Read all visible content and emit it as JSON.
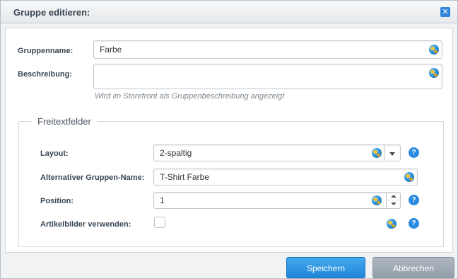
{
  "window": {
    "title": "Gruppe editieren:",
    "close_symbol": "✕"
  },
  "form": {
    "name_label": "Gruppenname:",
    "name_value": "Farbe",
    "description_label": "Beschreibung:",
    "description_value": "",
    "description_hint": "Wird im Storefront als Gruppenbeschreibung angezeigt"
  },
  "freetext": {
    "legend": "Freitextfelder",
    "layout_label": "Layout:",
    "layout_value": "2-spaltig",
    "alt_name_label": "Alternativer Gruppen-Name:",
    "alt_name_value": "T-Shirt Farbe",
    "position_label": "Position:",
    "position_value": "1",
    "images_label": "Artikelbilder verwenden:",
    "images_checked": false,
    "help_symbol": "?"
  },
  "footer": {
    "save_label": "Speichern",
    "cancel_label": "Abbrechen"
  },
  "colors": {
    "primary": "#1f86d8",
    "secondary": "#939ea9",
    "help": "#2a8ae0"
  },
  "icons": [
    "close-icon",
    "globe-icon",
    "help-icon",
    "chevron-down-icon",
    "spin-up-icon",
    "spin-down-icon"
  ]
}
